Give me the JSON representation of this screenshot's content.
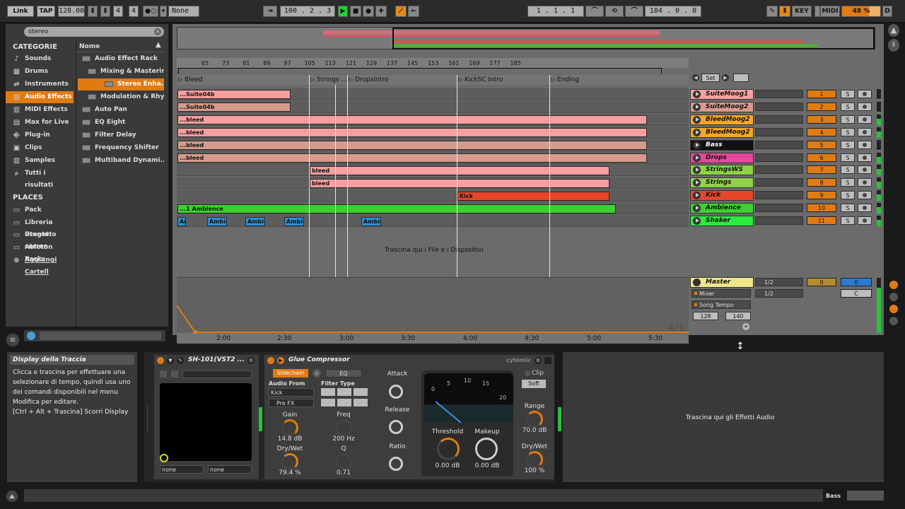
{
  "transport": {
    "link": "Link",
    "tap": "TAP",
    "tempo": "128.00",
    "sig_num": "4",
    "sig_den": "4",
    "quantize": "None",
    "position": "100 . 2 . 3",
    "loop_start": "1 . 1 . 1",
    "loop_len": "184 . 0 . 0",
    "key": "KEY",
    "midi": "MIDI",
    "cpu": "48 %",
    "d": "D"
  },
  "browser": {
    "search_value": "stereo",
    "categories_title": "CATEGORIE",
    "name_header": "Nome",
    "categories": [
      {
        "label": "Sounds",
        "icon": "♪"
      },
      {
        "label": "Drums",
        "icon": "▦"
      },
      {
        "label": "Instruments",
        "icon": "⇌"
      },
      {
        "label": "Audio Effects",
        "icon": "▥"
      },
      {
        "label": "MIDI Effects",
        "icon": "▥"
      },
      {
        "label": "Max for Live",
        "icon": "▤"
      },
      {
        "label": "Plug-in",
        "icon": "⎆"
      },
      {
        "label": "Clips",
        "icon": "▣"
      },
      {
        "label": "Samples",
        "icon": "▥"
      },
      {
        "label": "Tutti i risultati",
        "icon": "⌕"
      }
    ],
    "places_title": "PLACES",
    "places": [
      {
        "label": "Pack",
        "icon": "▭"
      },
      {
        "label": "Libreria Utente",
        "icon": "▭"
      },
      {
        "label": "Progetto corren",
        "icon": "▭"
      },
      {
        "label": "Ableton Packs",
        "icon": "▭"
      },
      {
        "label": "Aggiungi Cartell",
        "icon": "⊕"
      }
    ],
    "files": [
      "Audio Effect Rack",
      "Mixing & Mastering",
      "Stereo Enha...",
      "Modulation & Rhyth...",
      "Auto Pan",
      "EQ Eight",
      "Filter Delay",
      "Frequency Shifter",
      "Multiband Dynami..."
    ]
  },
  "arrangement": {
    "bars": [
      "65",
      "73",
      "81",
      "89",
      "97",
      "105",
      "113",
      "121",
      "129",
      "137",
      "145",
      "153",
      "161",
      "169",
      "177",
      "185"
    ],
    "locators": [
      "Bleed",
      "Strings ...",
      "DropsIntro",
      "KickSC Intro",
      "Ending"
    ],
    "times": [
      "2:00",
      "2:30",
      "3:00",
      "3:30",
      "4:00",
      "4:30",
      "5:00",
      "5:30"
    ],
    "drop_hint": "Trascina qui i File e i Dispositivi",
    "signature": "4/1",
    "set_label": "Set",
    "clips": {
      "suite1": "...Suite04b",
      "suite2": "...Suite04b",
      "bleed": "...bleed",
      "bleed_s": "bleed",
      "kick": "Kick",
      "amb": "...1 Ambience",
      "ambi": "Ambie"
    }
  },
  "tracks": [
    {
      "name": "SuiteMoog1",
      "num": "1",
      "color": "#f79ea0"
    },
    {
      "name": "SuiteMoog2",
      "num": "2",
      "color": "#d69b8c"
    },
    {
      "name": "BleedMoog2",
      "num": "3",
      "color": "#f5a623"
    },
    {
      "name": "BleedMoog2",
      "num": "4",
      "color": "#f5a623"
    },
    {
      "name": "Bass",
      "num": "5",
      "color": "#111111"
    },
    {
      "name": "Drops",
      "num": "6",
      "color": "#e8479a"
    },
    {
      "name": "StringsWS",
      "num": "7",
      "color": "#8fd147"
    },
    {
      "name": "Strings",
      "num": "8",
      "color": "#8fd147"
    },
    {
      "name": "Kick",
      "num": "9",
      "color": "#e8452b"
    },
    {
      "name": "Ambience",
      "num": "10",
      "color": "#3cd12e"
    },
    {
      "name": "Shaker",
      "num": "11",
      "color": "#2bea3e"
    }
  ],
  "master": {
    "name": "Master",
    "mixer": "Mixer",
    "song_tempo": "Song Tempo",
    "tempo_min": "128",
    "tempo_max": "140",
    "io1": "1/2",
    "io2": "1/2",
    "vol": "0",
    "pan": "0",
    "pan_c": "C"
  },
  "info": {
    "title": "Display della Traccia",
    "lines": [
      "Clicca e trascina per effettuare una",
      "selezionare di tempo, quindi usa uno",
      "dei comandi disponibili nel menu",
      "Modifica per editare.",
      "[Ctrl + Alt + Trascina] Scorri Display"
    ]
  },
  "device1": {
    "name": "SH-101(VST2 ...",
    "sel1": "none",
    "sel2": "none"
  },
  "glue": {
    "name": "Glue Compressor",
    "brand": "cytomic",
    "sidechain": "Sidechain",
    "eq": "EQ",
    "audio_from": "Audio From",
    "audio_from_val": "Kick",
    "prefx": "Pre FX",
    "filter_type": "Filter Type",
    "gain": "Gain",
    "gain_val": "14.8 dB",
    "drywet": "Dry/Wet",
    "drywet_val": "79.4 %",
    "freq": "Freq",
    "freq_val": "200 Hz",
    "q": "Q",
    "q_val": "0.71",
    "attack": "Attack",
    "release": "Release",
    "ratio": "Ratio",
    "threshold": "Threshold",
    "threshold_val": "0.00 dB",
    "makeup": "Makeup",
    "makeup_val": "0.00 dB",
    "clip": "Clip",
    "soft": "Soft",
    "range": "Range",
    "range_val": "70.0 dB",
    "drywet2": "Dry/Wet",
    "drywet2_val": "100 %",
    "meter_ticks": [
      "0",
      "5",
      "10",
      "15",
      "20"
    ]
  },
  "drop_effects": "Trascina qui gli Effetti Audio",
  "status": {
    "track": "Bass"
  }
}
